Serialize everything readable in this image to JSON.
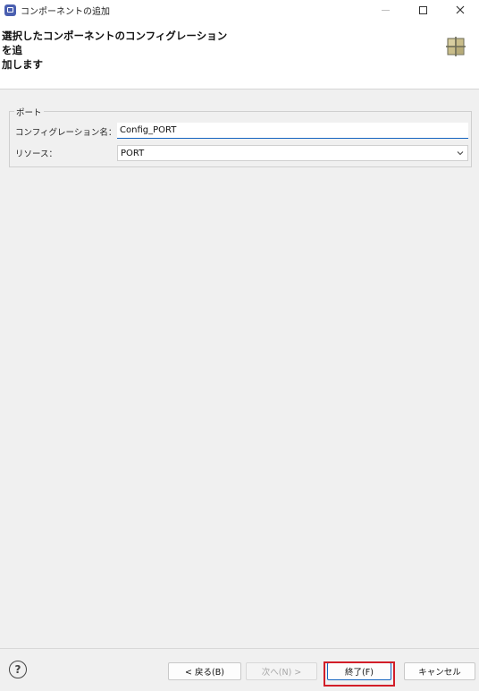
{
  "window": {
    "title": "コンポーネントの追加",
    "icon": "app-icon"
  },
  "header": {
    "title": "選択したコンポーネントのコンフィグレーションを追加します",
    "title_line1": "選択したコンポーネントのコンフィグレーションを追",
    "title_line2": "加します",
    "icon": "component-grid-icon"
  },
  "group": {
    "label": "ポート",
    "config_name_label": "コンフィグレーション名：",
    "config_name_value": "Config_PORT",
    "resource_label": "リソース：",
    "resource_value": "PORT"
  },
  "buttons": {
    "back": "< 戻る(B)",
    "next": "次へ(N) >",
    "finish": "終了(F)",
    "cancel": "キャンセル"
  },
  "help": "?",
  "colors": {
    "accent": "#1565c0",
    "highlight": "#d21e28",
    "app_icon": "#4a5fb0"
  }
}
